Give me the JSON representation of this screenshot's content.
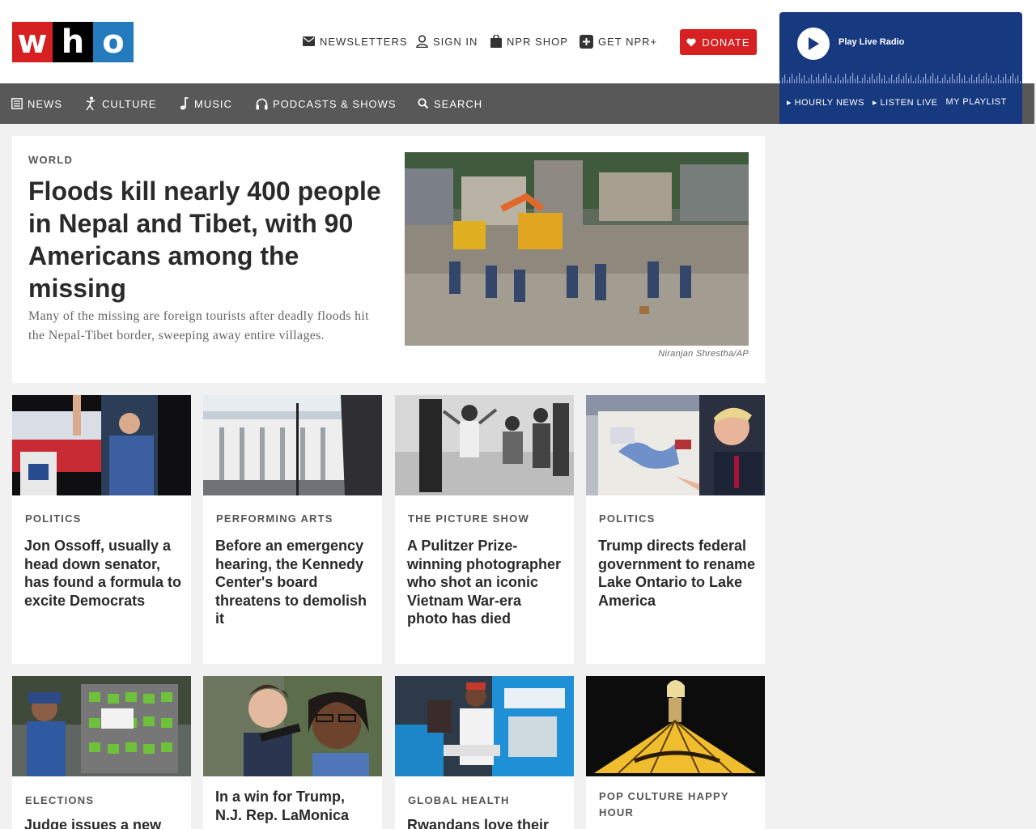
{
  "brand": {
    "letters": [
      "w",
      "h",
      "o"
    ],
    "colors": [
      "#d62021",
      "#000000",
      "#237bbd"
    ]
  },
  "utility_nav": {
    "newsletters": "NEWSLETTERS",
    "sign_in": "SIGN IN",
    "shop": "NPR SHOP",
    "plus": "GET NPR+",
    "donate": "DONATE"
  },
  "main_nav": [
    {
      "label": "NEWS",
      "icon": "news-icon"
    },
    {
      "label": "CULTURE",
      "icon": "culture-icon"
    },
    {
      "label": "MUSIC",
      "icon": "music-note-icon"
    },
    {
      "label": "PODCASTS & SHOWS",
      "icon": "headphones-icon"
    },
    {
      "label": "SEARCH",
      "icon": "search-icon"
    }
  ],
  "live_radio": {
    "label": "Play Live Radio",
    "links": [
      "HOURLY NEWS",
      "LISTEN LIVE",
      "MY PLAYLIST"
    ]
  },
  "hero": {
    "kicker": "WORLD",
    "headline": "Floods kill nearly 400 people in Nepal and Tibet, with 90 Americans among the missing",
    "teaser": "Many of the missing are foreign tourists after deadly floods hit the Nepal-Tibet border, sweeping away entire villages.",
    "credit": "Niranjan Shrestha/AP"
  },
  "cards": [
    {
      "kicker": "POLITICS",
      "headline": "Jon Ossoff, usually a head down senator, has found a formula to excite Democrats"
    },
    {
      "kicker": "PERFORMING ARTS",
      "headline": "Before an emergency hearing, the Kennedy Center's board threatens to demolish it"
    },
    {
      "kicker": "THE PICTURE SHOW",
      "headline": "A Pulitzer Prize-winning photographer who shot an iconic Vietnam War-era photo has died"
    },
    {
      "kicker": "POLITICS",
      "headline": "Trump directs federal government to rename Lake Ontario to Lake America"
    },
    {
      "kicker": "ELECTIONS",
      "headline": "Judge issues a new"
    },
    {
      "kicker": "",
      "headline": "In a win for Trump, N.J. Rep. LaMonica"
    },
    {
      "kicker": "GLOBAL HEALTH",
      "headline": "Rwandans love their"
    },
    {
      "kicker": "POP CULTURE HAPPY HOUR",
      "headline": ""
    }
  ],
  "colors": {
    "accent_red": "#d62021",
    "nav_gray": "#585858",
    "radio_blue": "#17397f",
    "page_bg": "#f1f1f1"
  }
}
